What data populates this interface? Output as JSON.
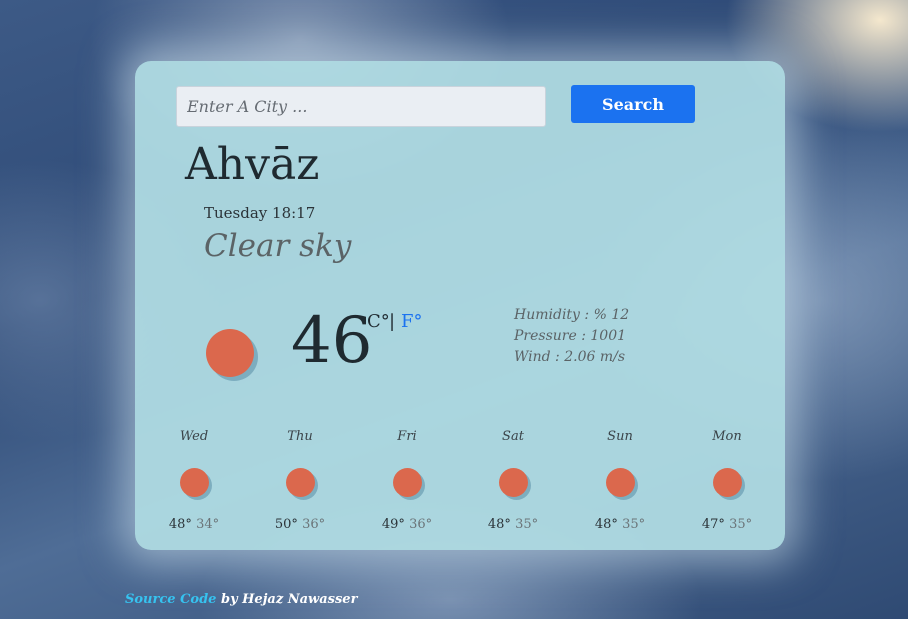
{
  "search": {
    "placeholder": "Enter A City ...",
    "button_label": "Search"
  },
  "current": {
    "city": "Ahvāz",
    "datetime": "Tuesday 18:17",
    "description": "Clear sky",
    "temperature": "46",
    "unit_c": "C°",
    "unit_separator": "|",
    "unit_f": "F°",
    "icon": "sun-icon",
    "humidity": "Humidity : % 12",
    "pressure": "Pressure : 1001",
    "wind": "Wind : 2.06 m/s"
  },
  "forecast": [
    {
      "day": "Wed",
      "high": "48°",
      "low": "34°",
      "icon": "sun-icon"
    },
    {
      "day": "Thu",
      "high": "50°",
      "low": "36°",
      "icon": "sun-icon"
    },
    {
      "day": "Fri",
      "high": "49°",
      "low": "36°",
      "icon": "sun-icon"
    },
    {
      "day": "Sat",
      "high": "48°",
      "low": "35°",
      "icon": "sun-icon"
    },
    {
      "day": "Sun",
      "high": "48°",
      "low": "35°",
      "icon": "sun-icon"
    },
    {
      "day": "Mon",
      "high": "47°",
      "low": "35°",
      "icon": "sun-icon"
    }
  ],
  "footer": {
    "link_text": "Source Code",
    "author_text": "by Hejaz Nawasser"
  },
  "colors": {
    "accent": "#1b72f0",
    "sun": "#db684d",
    "link": "#36c3f0"
  }
}
